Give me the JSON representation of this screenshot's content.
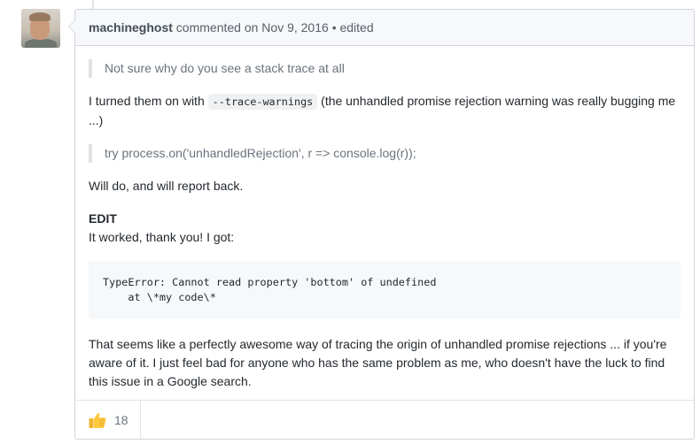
{
  "comment": {
    "author": "machineghost",
    "action": "commented on",
    "date": "Nov 9, 2016",
    "separator": "•",
    "edited": "edited"
  },
  "body": {
    "quote1": "Not sure why do you see a stack trace at all",
    "para1_before": "I turned them on with ",
    "para1_code": "--trace-warnings",
    "para1_after": " (the unhandled promise rejection warning was really bugging me ...)",
    "quote2": "try process.on('unhandledRejection', r => console.log(r));",
    "para2": "Will do, and will report back.",
    "edit_label": "EDIT",
    "edit_text": "It worked, thank you! I got:",
    "code_block": "TypeError: Cannot read property 'bottom' of undefined\n    at \\*my code\\*",
    "para3": "That seems like a perfectly awesome way of tracing the origin of unhandled promise rejections ... if you're aware of it. I just feel bad for anyone who has the same problem as me, who doesn't have the luck to find this issue in a Google search."
  },
  "reactions": [
    {
      "icon": "thumbs-up-icon",
      "count": "18"
    }
  ],
  "colors": {
    "border": "#d1d5da",
    "header_bg": "#f6f8fa",
    "muted_text": "#586069",
    "quote_text": "#6a737d",
    "thumb": "#ffc83d"
  }
}
